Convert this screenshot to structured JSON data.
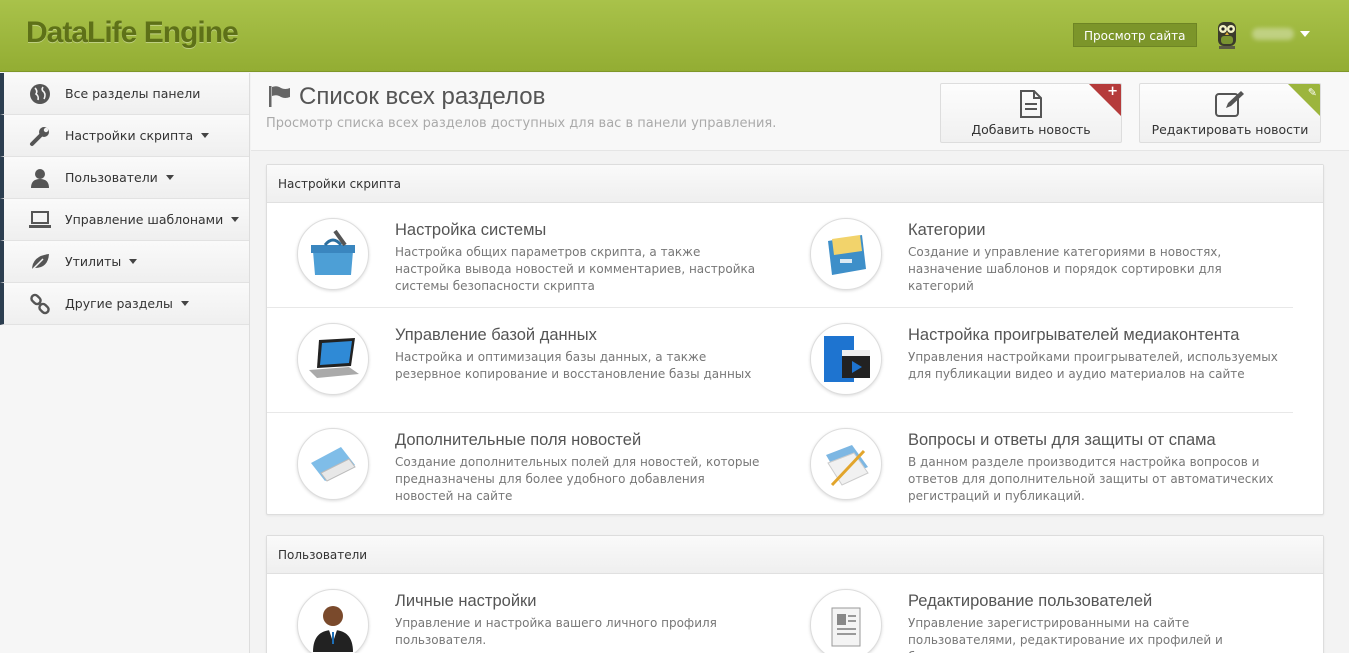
{
  "header": {
    "logo": "DataLife Engine",
    "view_site": "Просмотр сайта"
  },
  "sidebar": {
    "items": [
      {
        "label": "Все разделы панели",
        "icon": "globe-icon",
        "has_caret": false
      },
      {
        "label": "Настройки скрипта",
        "icon": "wrench-icon",
        "has_caret": true
      },
      {
        "label": "Пользователи",
        "icon": "user-icon",
        "has_caret": true
      },
      {
        "label": "Управление шаблонами",
        "icon": "laptop-icon",
        "has_caret": true
      },
      {
        "label": "Утилиты",
        "icon": "leaf-icon",
        "has_caret": true
      },
      {
        "label": "Другие разделы",
        "icon": "link-icon",
        "has_caret": true
      }
    ]
  },
  "page": {
    "title": "Список всех разделов",
    "subtitle": "Просмотр списка всех разделов доступных для вас в панели управления.",
    "quick": {
      "add": "Добавить новость",
      "edit": "Редактировать новости"
    }
  },
  "sections": [
    {
      "title": "Настройки скрипта",
      "items": [
        {
          "title": "Настройка системы",
          "desc": "Настройка общих параметров скрипта, а также настройка вывода новостей и комментариев, настройка системы безопасности скрипта",
          "icon": "toolbox-icon"
        },
        {
          "title": "Категории",
          "desc": "Создание и управление категориями в новостях, назначение шаблонов и порядок сортировки для категорий",
          "icon": "file-cabinet-icon"
        },
        {
          "title": "Управление базой данных",
          "desc": "Настройка и оптимизация базы данных, а также резервное копирование и восстановление базы данных",
          "icon": "laptop-icon"
        },
        {
          "title": "Настройка проигрывателей медиаконтента",
          "desc": "Управления настройками проигрывателей, используемых для публикации видео и аудио материалов на сайте",
          "icon": "media-player-icon"
        },
        {
          "title": "Дополнительные поля новостей",
          "desc": "Создание дополнительных полей для новостей, которые предназначены для более удобного добавления новостей на сайте",
          "icon": "fields-icon"
        },
        {
          "title": "Вопросы и ответы для защиты от спама",
          "desc": "В данном разделе производится настройка вопросов и ответов для дополнительной защиты от автоматических регистраций и публикаций.",
          "icon": "notes-icon"
        }
      ]
    },
    {
      "title": "Пользователи",
      "items": [
        {
          "title": "Личные настройки",
          "desc": "Управление и настройка вашего личного профиля пользователя.",
          "icon": "person-icon"
        },
        {
          "title": "Редактирование пользователей",
          "desc": "Управление зарегистрированными на сайте пользователями, редактирование их профилей и блокировка аккаунта",
          "icon": "document-icon"
        }
      ]
    }
  ]
}
